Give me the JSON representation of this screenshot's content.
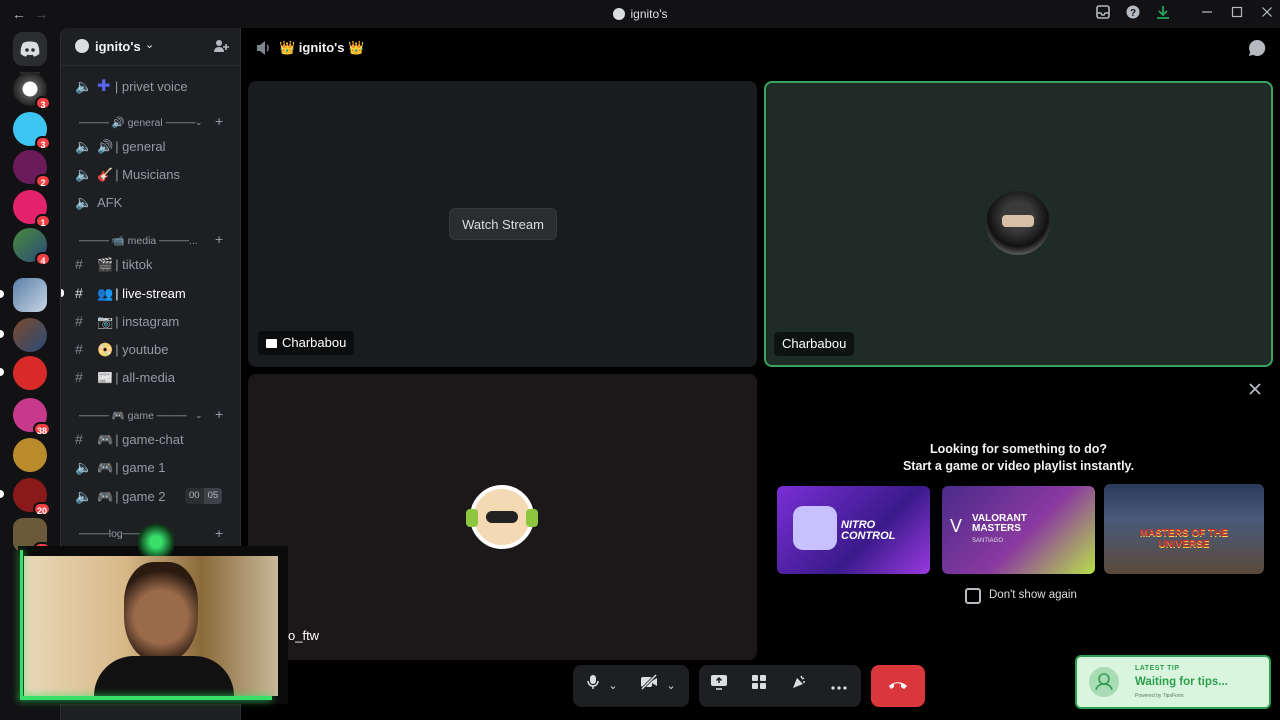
{
  "window": {
    "title": "ignito's",
    "back": "←",
    "forward": "→"
  },
  "servers": [
    {
      "badge": "3"
    },
    {
      "badge": "3"
    },
    {
      "badge": "2"
    },
    {
      "badge": "1"
    },
    {
      "badge": "4"
    },
    {
      "badge": ""
    },
    {
      "badge": ""
    },
    {
      "badge": ""
    },
    {
      "badge": "38"
    },
    {
      "badge": ""
    },
    {
      "badge": "20"
    },
    {
      "badge": "18"
    }
  ],
  "server": {
    "name": "ignito's"
  },
  "channels": {
    "top": [
      {
        "label": "| privet voice"
      }
    ],
    "general_category": "──── 🔊 general ────",
    "general": [
      {
        "label": "| general"
      },
      {
        "label": "| Musicians"
      },
      {
        "label": "AFK"
      }
    ],
    "media_category": "──── 📹 media ────...",
    "media": [
      {
        "label": "| tiktok"
      },
      {
        "label": "| live-stream"
      },
      {
        "label": "| instagram"
      },
      {
        "label": "| youtube"
      },
      {
        "label": "| all-media"
      }
    ],
    "game_category": "──── 🎮 game ────",
    "game": [
      {
        "label": "| game-chat"
      },
      {
        "label": "| game 1"
      },
      {
        "label": "| game 2"
      }
    ],
    "game2_count_a": "00",
    "game2_count_b": "05",
    "log_category": "────log────"
  },
  "voice_header": {
    "title": "👑 ignito's 👑"
  },
  "tiles": {
    "stream_button": "Watch Stream",
    "stream_user": "Charbabou",
    "camera_user": "Charbabou",
    "third_user": "o_ftw"
  },
  "activity": {
    "heading1": "Looking for something to do?",
    "heading2": "Start a game or video playlist instantly.",
    "dont_show": "Don't show again",
    "cards": [
      "NITRO CONTROL",
      "VALORANT MASTERS",
      "MASTERS OF THE UNIVERSE"
    ],
    "card_sub": [
      "",
      "SANTIAGO",
      ""
    ]
  },
  "tip": {
    "label": "LATEST TIP",
    "text": "Waiting for tips...",
    "powered": "Powered by TipsForm"
  },
  "colors": {
    "accent": "#5865f2",
    "danger": "#da373c",
    "speaking": "#3ba55c",
    "tip_bg": "#d9f5dd"
  }
}
